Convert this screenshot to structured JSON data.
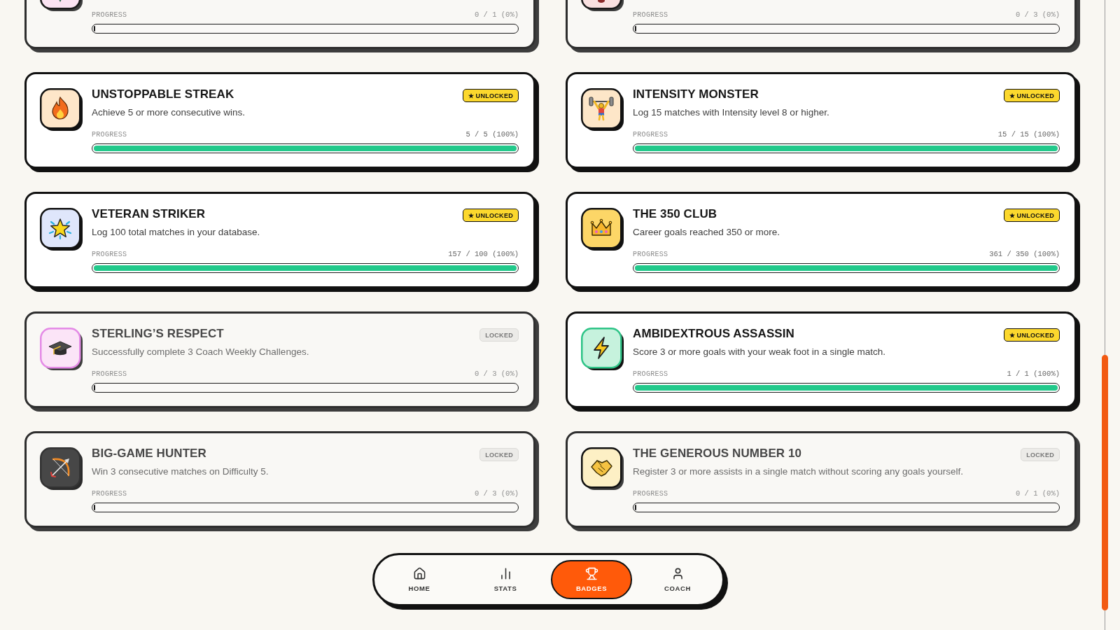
{
  "badges": [
    {
      "progress_label": "PROGRESS",
      "progress_text": "0 / 1 (0%)",
      "level": 0,
      "unlocked": false
    },
    {
      "progress_label": "PROGRESS",
      "progress_text": "0 / 3 (0%)",
      "level": 0,
      "unlocked": false
    },
    {
      "title": "UNSTOPPABLE STREAK",
      "description": "Achieve 5 or more consecutive wins.",
      "status": "★ UNLOCKED",
      "progress_label": "PROGRESS",
      "progress_text": "5 / 5 (100%)",
      "level": 1,
      "unlocked": true
    },
    {
      "title": "INTENSITY MONSTER",
      "description": "Log 15 matches with Intensity level 8 or higher.",
      "status": "★ UNLOCKED",
      "progress_label": "PROGRESS",
      "progress_text": "15 / 15 (100%)",
      "level": 1,
      "unlocked": true
    },
    {
      "title": "VETERAN STRIKER",
      "description": "Log 100 total matches in your database.",
      "status": "★ UNLOCKED",
      "progress_label": "PROGRESS",
      "progress_text": "157 / 100 (100%)",
      "level": 1,
      "unlocked": true
    },
    {
      "title": "THE 350 CLUB",
      "description": "Career goals reached 350 or more.",
      "status": "★ UNLOCKED",
      "progress_label": "PROGRESS",
      "progress_text": "361 / 350 (100%)",
      "level": 1,
      "unlocked": true
    },
    {
      "title": "STERLING’S RESPECT",
      "description": "Successfully complete 3 Coach Weekly Challenges.",
      "status": "LOCKED",
      "progress_label": "PROGRESS",
      "progress_text": "0 / 3 (0%)",
      "level": 0,
      "unlocked": false
    },
    {
      "title": "AMBIDEXTROUS ASSASSIN",
      "description": "Score 3 or more goals with your weak foot in a single match.",
      "status": "★ UNLOCKED",
      "progress_label": "PROGRESS",
      "progress_text": "1 / 1 (100%)",
      "level": 1,
      "unlocked": true
    },
    {
      "title": "BIG-GAME HUNTER",
      "description": "Win 3 consecutive matches on Difficulty 5.",
      "status": "LOCKED",
      "progress_label": "PROGRESS",
      "progress_text": "0 / 3 (0%)",
      "level": 0,
      "unlocked": false
    },
    {
      "title": "THE GENEROUS NUMBER 10",
      "description": "Register 3 or more assists in a single match without scoring any goals yourself.",
      "status": "LOCKED",
      "progress_label": "PROGRESS",
      "progress_text": "0 / 1 (0%)",
      "level": 0,
      "unlocked": false
    }
  ],
  "nav": [
    {
      "label": "HOME",
      "selected": false
    },
    {
      "label": "STATS",
      "selected": false
    },
    {
      "label": "BADGES",
      "selected": true
    },
    {
      "label": "COACH",
      "selected": false
    }
  ]
}
